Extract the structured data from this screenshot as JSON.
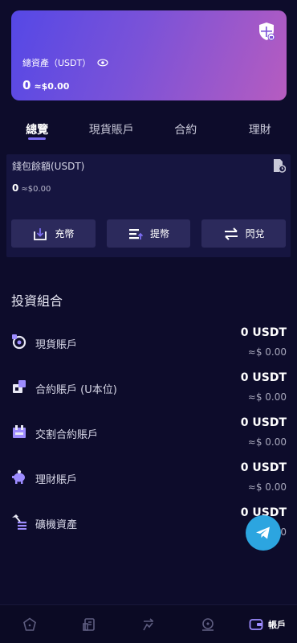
{
  "card": {
    "label": "總資產（USDT）",
    "amount": "0",
    "approx": "≈$0.00"
  },
  "tabs": [
    {
      "label": "總覽",
      "active": true
    },
    {
      "label": "現貨賬戶",
      "active": false
    },
    {
      "label": "合約",
      "active": false
    },
    {
      "label": "理財",
      "active": false
    }
  ],
  "wallet": {
    "title": "錢包餘額(USDT)",
    "balance": "0",
    "approx": "≈$0.00",
    "buttons": {
      "deposit": "充幣",
      "withdraw": "提幣",
      "swap": "閃兌"
    }
  },
  "portfolio": {
    "title": "投資組合",
    "rows": [
      {
        "name": "現貨賬戶",
        "usdt": "0 USDT",
        "usd": "≈$ 0.00"
      },
      {
        "name": "合約賬戶 (U本位)",
        "usdt": "0 USDT",
        "usd": "≈$ 0.00"
      },
      {
        "name": "交割合約賬戶",
        "usdt": "0 USDT",
        "usd": "≈$ 0.00"
      },
      {
        "name": "理財賬戶",
        "usdt": "0 USDT",
        "usd": "≈$ 0.00"
      },
      {
        "name": "礦機資產",
        "usdt": "0 USDT",
        "usd": "≈$ 0.00"
      }
    ]
  },
  "nav": {
    "account_label": "帳戶"
  },
  "colors": {
    "accent": "#7b6cf0",
    "background": "#0d0c2b",
    "telegram": "#2ca5e0"
  }
}
